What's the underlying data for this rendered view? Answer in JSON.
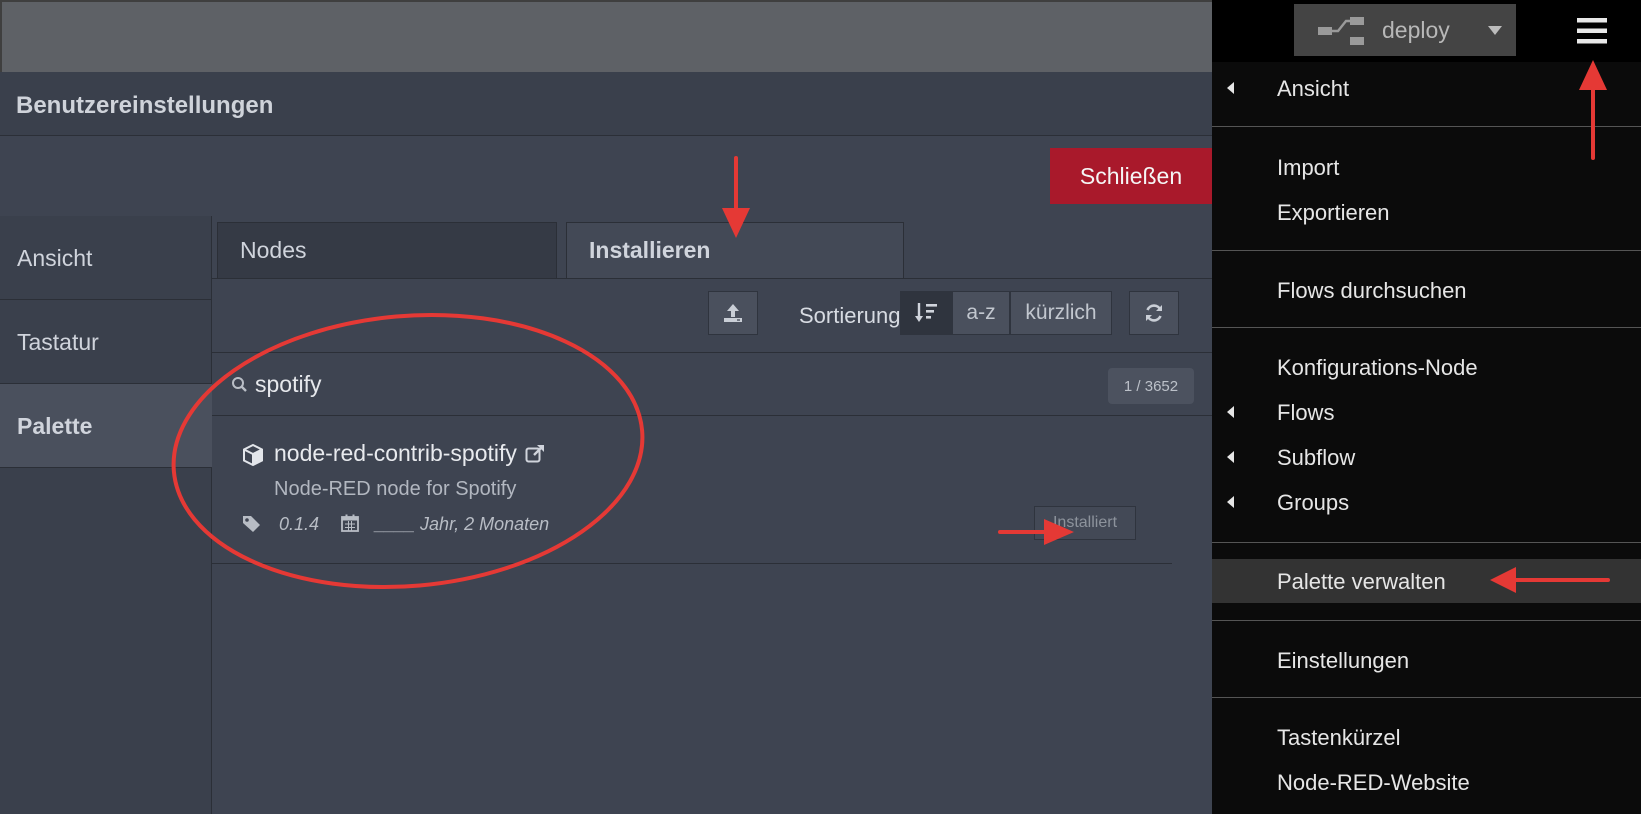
{
  "dialog": {
    "title": "Benutzereinstellungen",
    "close_label": "Schließen",
    "sidebar": [
      {
        "label": "Ansicht",
        "active": false
      },
      {
        "label": "Tastatur",
        "active": false
      },
      {
        "label": "Palette",
        "active": true
      }
    ],
    "tabs": [
      {
        "label": "Nodes",
        "active": false
      },
      {
        "label": "Installieren",
        "active": true
      }
    ],
    "toolbar": {
      "sort_label": "Sortierung:",
      "sort_az": "a-z",
      "sort_recent": "kürzlich"
    },
    "search": {
      "value": "spotify",
      "count": "1 / 3652"
    },
    "result": {
      "name": "node-red-contrib-spotify",
      "description": "Node-RED node for Spotify",
      "version": "0.1.4",
      "date": "____ Jahr, 2 Monaten",
      "install_label": "Installiert"
    }
  },
  "header": {
    "deploy_label": "deploy"
  },
  "menu": {
    "items": [
      {
        "label": "Ansicht",
        "submenu": true
      },
      {
        "label": "Import",
        "submenu": false
      },
      {
        "label": "Exportieren",
        "submenu": false
      },
      {
        "label": "Flows durchsuchen",
        "submenu": false
      },
      {
        "label": "Konfigurations-Node",
        "submenu": false
      },
      {
        "label": "Flows",
        "submenu": true
      },
      {
        "label": "Subflow",
        "submenu": true
      },
      {
        "label": "Groups",
        "submenu": true
      },
      {
        "label": "Palette verwalten",
        "submenu": false,
        "highlighted": true
      },
      {
        "label": "Einstellungen",
        "submenu": false
      },
      {
        "label": "Tastenkürzel",
        "submenu": false
      },
      {
        "label": "Node-RED-Website",
        "submenu": false
      }
    ]
  },
  "colors": {
    "close_button": "#a9192b",
    "annotation": "#e53935"
  }
}
